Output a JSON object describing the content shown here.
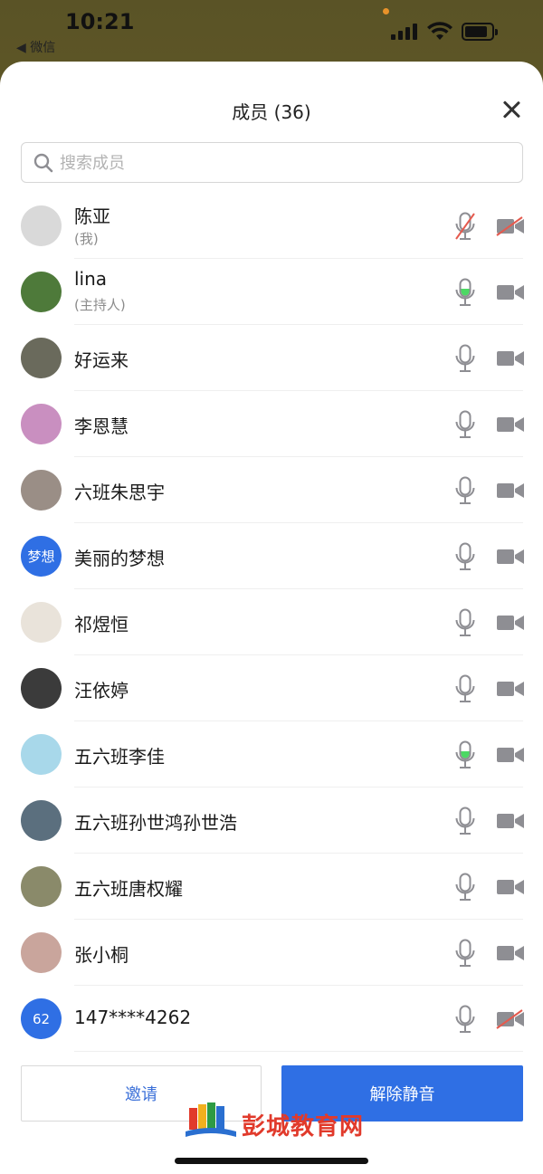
{
  "status": {
    "time": "10:21",
    "back_app": "◀ 微信"
  },
  "sheet": {
    "title": "成员 (36)"
  },
  "search": {
    "placeholder": "搜索成员"
  },
  "members": [
    {
      "name": "陈亚",
      "role": "(我)",
      "mic": "muted",
      "cam": "off",
      "avatar_color": "#d9d9d9"
    },
    {
      "name": "lina",
      "role": "(主持人)",
      "mic": "active",
      "cam": "on",
      "avatar_color": "#4e7a3a"
    },
    {
      "name": "好运来",
      "mic": "idle",
      "cam": "on",
      "avatar_color": "#6a6a5c"
    },
    {
      "name": "李恩慧",
      "mic": "idle",
      "cam": "on",
      "avatar_color": "#c98fc0"
    },
    {
      "name": "六班朱思宇",
      "mic": "idle",
      "cam": "on",
      "avatar_color": "#9a8e86"
    },
    {
      "name": "美丽的梦想",
      "avatar_text": "梦想",
      "mic": "idle",
      "cam": "on",
      "avatar_color": "#2f6fe4"
    },
    {
      "name": "祁煜恒",
      "mic": "idle",
      "cam": "on",
      "avatar_color": "#e9e3da"
    },
    {
      "name": "汪依婷",
      "mic": "idle",
      "cam": "on",
      "avatar_color": "#3b3b3b"
    },
    {
      "name": "五六班李佳",
      "mic": "active",
      "cam": "on",
      "avatar_color": "#a8d8ea"
    },
    {
      "name": "五六班孙世鸿孙世浩",
      "mic": "idle",
      "cam": "on",
      "avatar_color": "#5b6f7e"
    },
    {
      "name": "五六班唐权耀",
      "mic": "idle",
      "cam": "on",
      "avatar_color": "#8a8a6a"
    },
    {
      "name": "张小桐",
      "mic": "idle",
      "cam": "on",
      "avatar_color": "#c9a59c"
    },
    {
      "name": "147****4262",
      "avatar_text": "62",
      "mic": "idle",
      "cam": "off",
      "avatar_color": "#2f6fe4"
    }
  ],
  "buttons": {
    "invite": "邀请",
    "unmute": "解除静音"
  },
  "watermark": "彭城教育网",
  "colors": {
    "accent": "#2f6fe4",
    "mic_active": "#4cd964",
    "off_red": "#e55a4e",
    "icon_gray": "#8e8e93"
  }
}
